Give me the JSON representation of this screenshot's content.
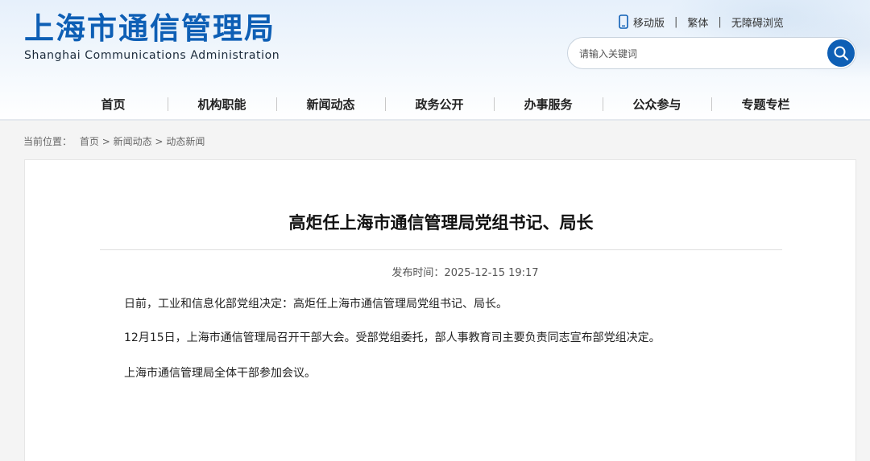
{
  "header": {
    "logo_cn": "上海市通信管理局",
    "logo_en": "Shanghai Communications Administration",
    "links": {
      "mobile": "移动版",
      "traditional": "繁体",
      "accessible": "无障碍浏览",
      "separator": "|"
    },
    "search": {
      "placeholder": "请输入关键词",
      "icon": "search-icon"
    },
    "brand_color": "#0e5fb5"
  },
  "nav": {
    "items": [
      "首页",
      "机构职能",
      "新闻动态",
      "政务公开",
      "办事服务",
      "公众参与",
      "专题专栏"
    ]
  },
  "breadcrumb": {
    "label": "当前位置：",
    "items": [
      "首页",
      "新闻动态",
      "动态新闻"
    ],
    "separator": ">"
  },
  "article": {
    "title": "高炬任上海市通信管理局党组书记、局长",
    "publish_label": "发布时间：",
    "publish_time": "2025-12-15 19:17",
    "paragraphs": [
      "日前，工业和信息化部党组决定：高炬任上海市通信管理局党组书记、局长。",
      "12月15日，上海市通信管理局召开干部大会。受部党组委托，部人事教育司主要负责同志宣布部党组决定。",
      "上海市通信管理局全体干部参加会议。"
    ]
  }
}
